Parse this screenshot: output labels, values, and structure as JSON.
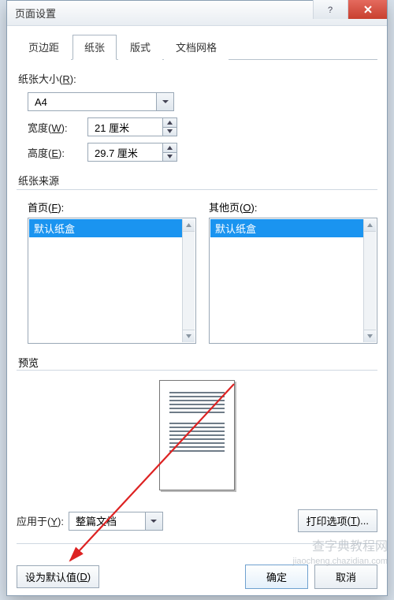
{
  "title": "页面设置",
  "tabs": [
    "页边距",
    "纸张",
    "版式",
    "文档网格"
  ],
  "active_tab_index": 1,
  "paper_size": {
    "label": "纸张大小",
    "accel": "R",
    "value": "A4",
    "width_label": "宽度",
    "width_accel": "W",
    "width_value": "21 厘米",
    "height_label": "高度",
    "height_accel": "E",
    "height_value": "29.7 厘米"
  },
  "paper_source": {
    "label": "纸张来源",
    "first_page_label": "首页",
    "first_page_accel": "F",
    "other_pages_label": "其他页",
    "other_pages_accel": "O",
    "first_page_items": [
      "默认纸盒"
    ],
    "other_pages_items": [
      "默认纸盒"
    ],
    "selected_value": "默认纸盒"
  },
  "preview_label": "预览",
  "apply_to": {
    "label": "应用于",
    "accel": "Y",
    "value": "整篇文档"
  },
  "print_options": {
    "label": "打印选项",
    "accel": "T"
  },
  "set_default": {
    "label": "设为默认值",
    "accel": "D"
  },
  "ok_label": "确定",
  "cancel_label": "取消",
  "watermark": {
    "line1": "查字典教程网",
    "line2": "jiaocheng.chazidian.com"
  },
  "colors": {
    "selection": "#1a94f0",
    "close": "#c8402f"
  }
}
